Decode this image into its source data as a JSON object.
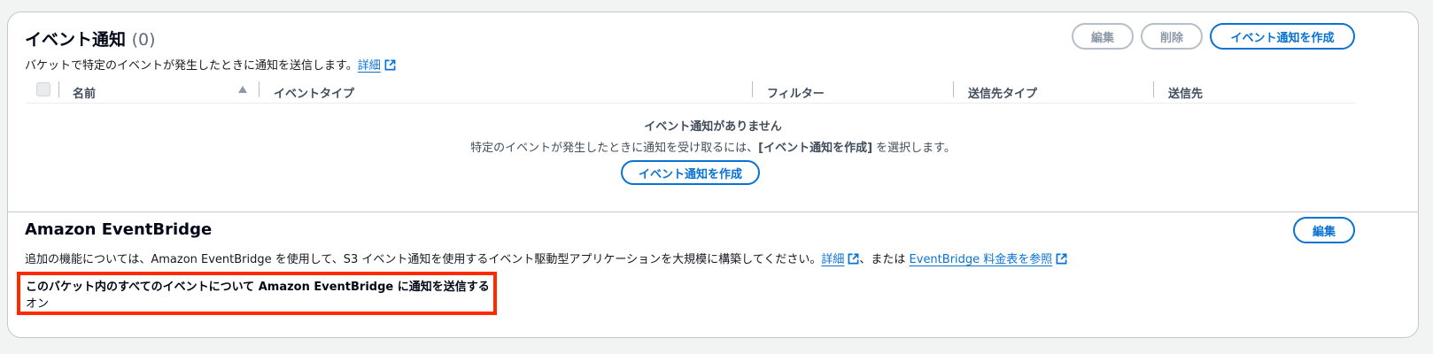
{
  "notifications": {
    "title": "イベント通知",
    "count": "(0)",
    "description": "バケットで特定のイベントが発生したときに通知を送信します。",
    "details_link": "詳細",
    "buttons": {
      "edit": "編集",
      "delete": "削除",
      "create": "イベント通知を作成"
    },
    "columns": [
      "名前",
      "イベントタイプ",
      "フィルター",
      "送信先タイプ",
      "送信先"
    ],
    "empty": {
      "title": "イベント通知がありません",
      "desc_before": "特定のイベントが発生したときに通知を受け取るには、",
      "desc_bold": "[イベント通知を作成]",
      "desc_after": " を選択します。",
      "button": "イベント通知を作成"
    }
  },
  "eventbridge": {
    "title": "Amazon EventBridge",
    "edit_button": "編集",
    "desc_before": "追加の機能については、Amazon EventBridge を使用して、S3 イベント通知を使用するイベント駆動型アプリケーションを大規模に構築してください。",
    "details_link": "詳細",
    "or_text": "、または",
    "pricing_link": "EventBridge 料金表を参照",
    "setting_label": "このバケット内のすべてのイベントについて Amazon EventBridge に通知を送信する",
    "setting_value": "オン"
  },
  "colors": {
    "link": "#0972d3",
    "highlight": "#ff2a00",
    "border": "#c6c6cd"
  }
}
